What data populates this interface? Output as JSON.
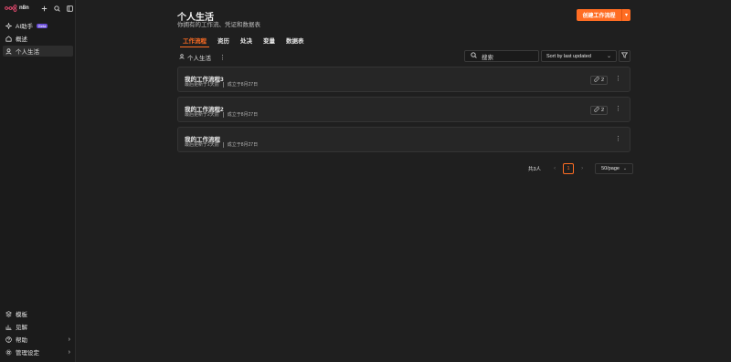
{
  "app": {
    "logo_text": "n8n"
  },
  "sidebar": {
    "items": [
      {
        "label": "AI助手",
        "badge": "Beta"
      },
      {
        "label": "概述"
      },
      {
        "label": "个人生活"
      }
    ],
    "bottom_items": [
      {
        "label": "模板"
      },
      {
        "label": "见解"
      },
      {
        "label": "帮助"
      },
      {
        "label": "管理设定"
      }
    ]
  },
  "header": {
    "title": "个人生活",
    "subtitle": "你拥有的工作流、凭证和数据表",
    "create_button": "创建工作流程"
  },
  "tabs": [
    {
      "label": "工作流程",
      "active": true
    },
    {
      "label": "资历"
    },
    {
      "label": "处决"
    },
    {
      "label": "变量"
    },
    {
      "label": "数据表"
    }
  ],
  "toolbar": {
    "project_label": "个人生活",
    "search_placeholder": "搜索",
    "sort_value": "Sort by last updated"
  },
  "workflows": [
    {
      "name": "我的工作流程3",
      "updated": "最后更新于1天前",
      "created": "成立于8月27日",
      "shares": "2"
    },
    {
      "name": "我的工作流程2",
      "updated": "最后更新于2天前",
      "created": "成立于8月27日",
      "shares": "2"
    },
    {
      "name": "我的工作流程",
      "updated": "最后更新于2天前",
      "created": "成立于8月27日",
      "shares": ""
    }
  ],
  "pagination": {
    "total": "共3人",
    "current_page": "1",
    "page_size": "50/page"
  },
  "colors": {
    "accent": "#ff6d23",
    "background": "#1f1f1f",
    "sidebar": "#1b1b1b"
  }
}
